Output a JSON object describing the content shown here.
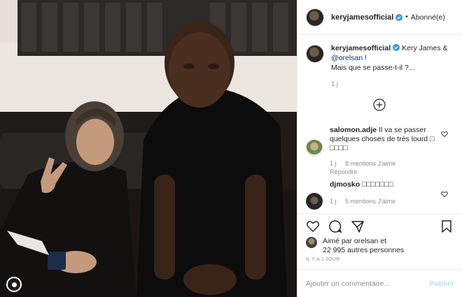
{
  "post": {
    "username": "keryjamesofficial",
    "follow_status": "Abonné(e)",
    "dot": "•",
    "caption": {
      "username": "keryjamesofficial",
      "text_before": " Kery James & ",
      "mention": "@orelsan",
      "text_after": " !",
      "line2": "Mais que se passe-t-il ?...",
      "time": "1 j"
    },
    "comments": [
      {
        "username": "salomon.adje",
        "text": " Il va se passer quelques choses de très lourd □ □□□□",
        "time": "1 j",
        "likes": "8 mentions J'aime",
        "reply": "Répondre"
      },
      {
        "username": "djmosko",
        "text": " □□□□□□□",
        "time": "1 j",
        "likes": "5 mentions J'aime"
      }
    ],
    "likes": {
      "line1": "Aimé par orelsan et",
      "line2": "22 995 autres personnes"
    },
    "date": "IL Y A 1 JOUR",
    "add_comment_placeholder": "Ajouter un commentaire...",
    "publish_label": "Publier"
  },
  "colors": {
    "verified": "#3897f0",
    "link": "#003569",
    "muted": "#8e8e8e",
    "publish_disabled": "#b2dffc"
  },
  "icons": [
    "verified-icon",
    "more-comments-icon",
    "heart-icon",
    "comment-icon",
    "share-icon",
    "bookmark-icon"
  ]
}
